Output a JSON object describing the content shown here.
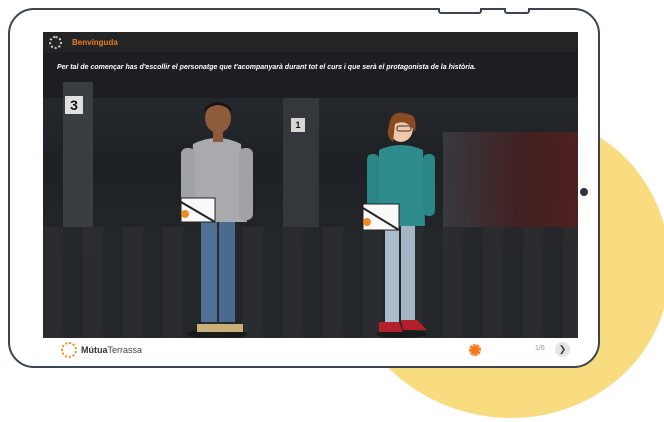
{
  "header": {
    "title": "Benvinguda",
    "logo_icon": "sun-logo-icon"
  },
  "content": {
    "instruction": "Per tal de començar has d'escollir el personatge que t'acompanyarà durant tot el curs i que serà el protagonista de la història.",
    "platform_number": "3",
    "sign_number": "1",
    "characters": [
      {
        "id": "male-character",
        "gender": "male"
      },
      {
        "id": "female-character",
        "gender": "female"
      }
    ]
  },
  "footer": {
    "brand_bold": "Mútua",
    "brand_rest": "Terrassa",
    "pager": "1/6",
    "next_icon": "chevron-right-icon",
    "orange_button_icon": "sun-icon"
  },
  "colors": {
    "accent": "#f07a1a",
    "decor": "#f9dc80",
    "frame": "#3c4652"
  }
}
